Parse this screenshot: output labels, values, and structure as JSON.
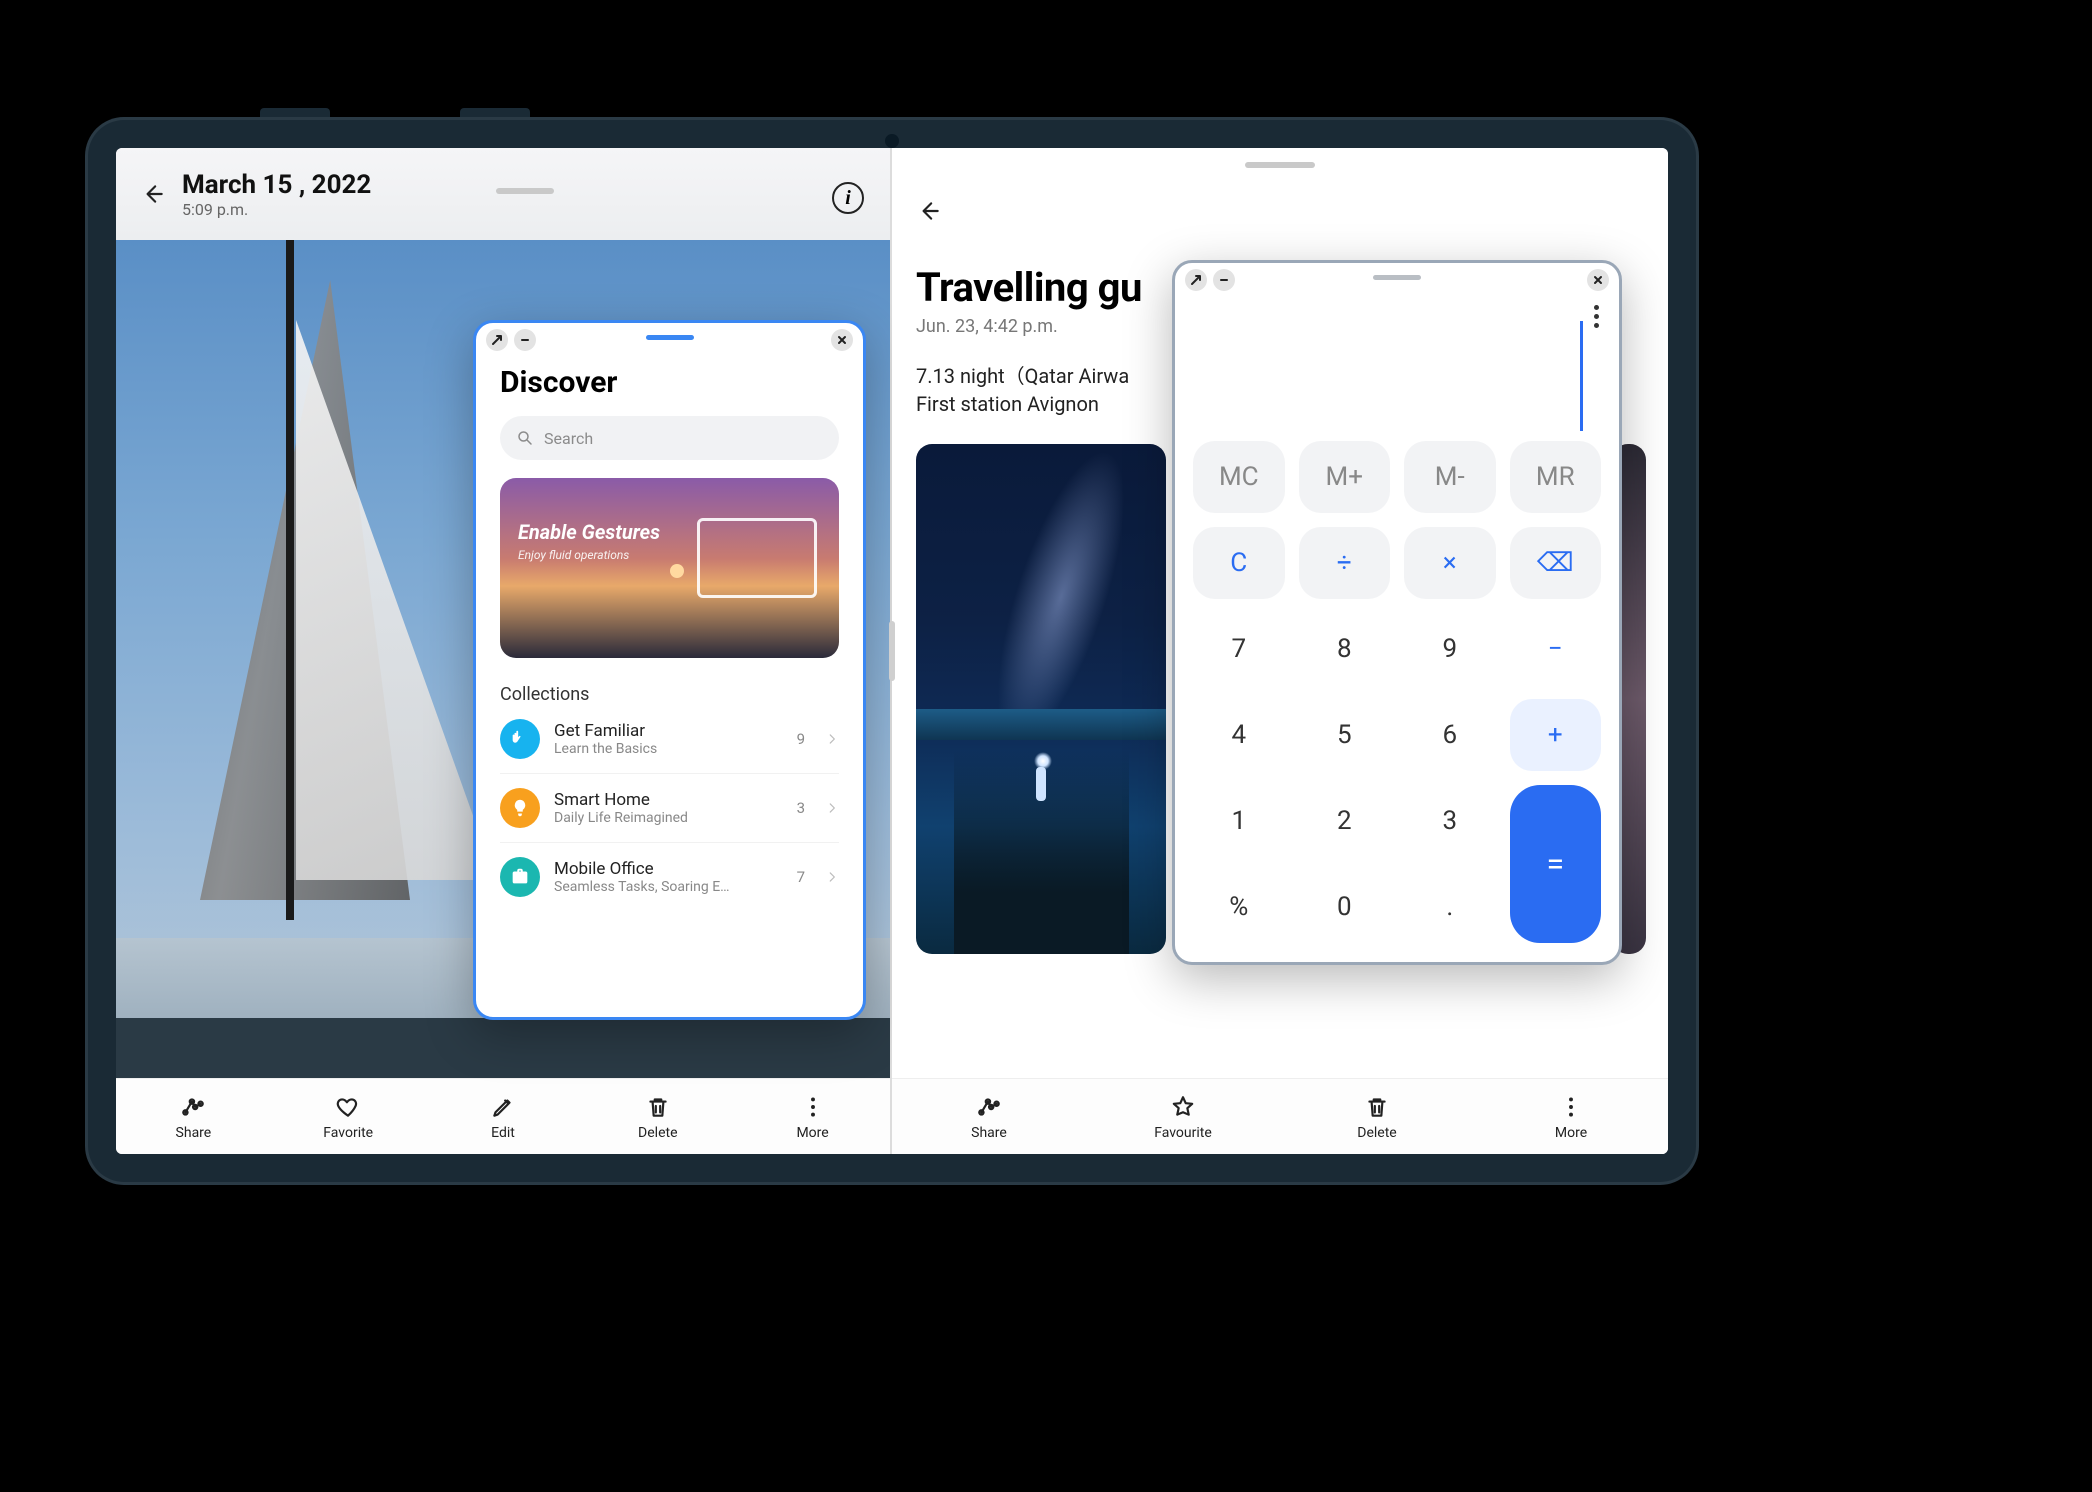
{
  "left_pane": {
    "header": {
      "date": "March 15 , 2022",
      "time": "5:09 p.m."
    },
    "bottom": {
      "share": "Share",
      "favorite": "Favorite",
      "edit": "Edit",
      "delete": "Delete",
      "more": "More"
    }
  },
  "right_pane": {
    "title": "Travelling gu",
    "date": "Jun. 23, 4:42 p.m.",
    "line1": "7.13 night（Qatar Airwa",
    "line2": "First station  Avignon",
    "bottom": {
      "share": "Share",
      "favourite": "Favourite",
      "delete": "Delete",
      "more": "More"
    }
  },
  "discover": {
    "title": "Discover",
    "search_placeholder": "Search",
    "card": {
      "title": "Enable Gestures",
      "subtitle": "Enjoy fluid operations"
    },
    "section": "Collections",
    "items": [
      {
        "title": "Get Familiar",
        "subtitle": "Learn the Basics",
        "count": "9",
        "color": "blue",
        "icon": "hand"
      },
      {
        "title": "Smart Home",
        "subtitle": "Daily Life Reimagined",
        "count": "3",
        "color": "orange",
        "icon": "bulb"
      },
      {
        "title": "Mobile Office",
        "subtitle": "Seamless Tasks, Soaring E…",
        "count": "7",
        "color": "teal",
        "icon": "briefcase"
      }
    ]
  },
  "calculator": {
    "keys": {
      "mc": "MC",
      "mplus": "M+",
      "mminus": "M-",
      "mr": "MR",
      "c": "C",
      "div": "÷",
      "mul": "×",
      "bksp": "⌫",
      "7": "7",
      "8": "8",
      "9": "9",
      "minus": "−",
      "4": "4",
      "5": "5",
      "6": "6",
      "plus": "+",
      "1": "1",
      "2": "2",
      "3": "3",
      "eq": "=",
      "pct": "%",
      "0": "0",
      "dot": "."
    }
  }
}
